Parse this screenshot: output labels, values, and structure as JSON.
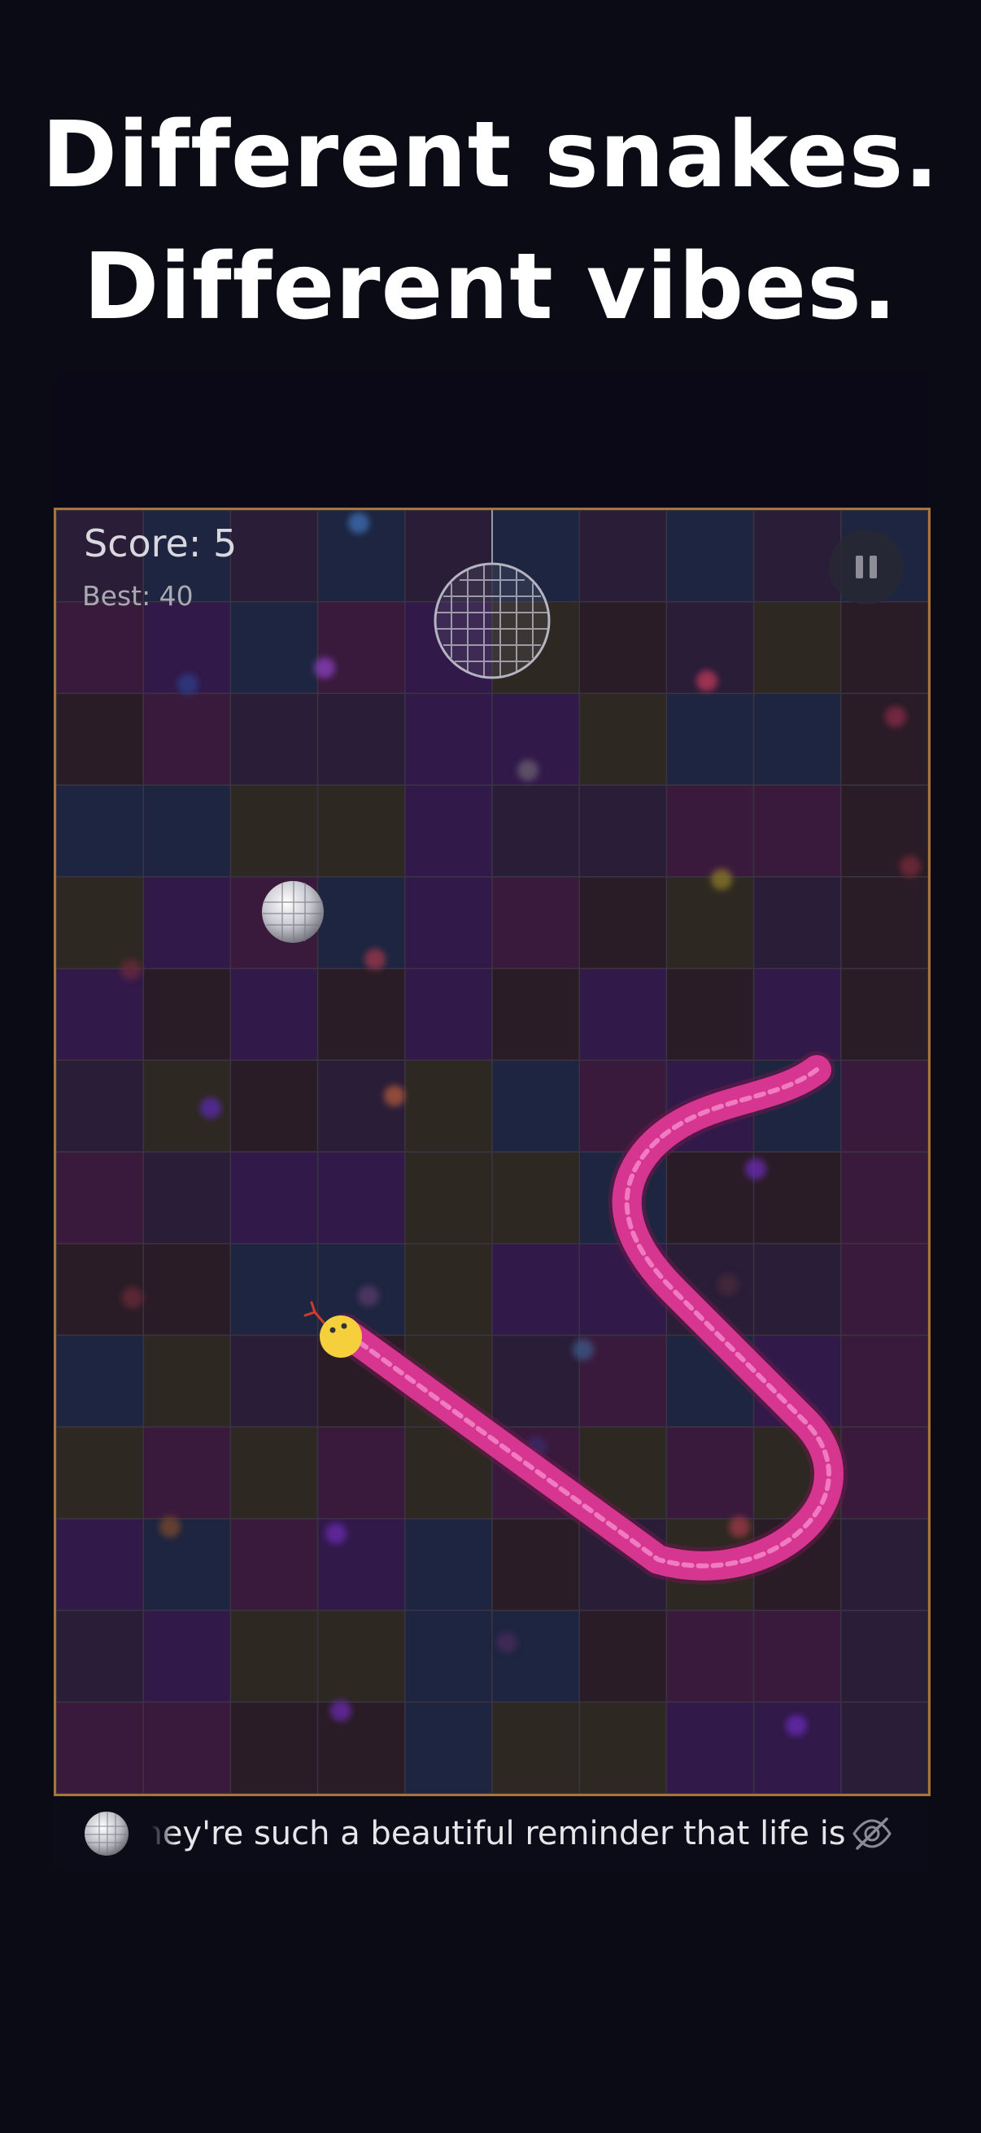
{
  "headline": {
    "line1": "Different snakes.",
    "line2": "Different vibes."
  },
  "hud": {
    "score_text": "Score: 5",
    "best_text": "Best: 40",
    "pause_icon": "pause-icon"
  },
  "board": {
    "columns": 10,
    "rows": 14,
    "border_color": "#a8743a",
    "tile_colors": [
      "#2a1d38",
      "#3a1a3c",
      "#2a1c26",
      "#1d2540",
      "#2e2822",
      "#31194a"
    ],
    "snake_color": "#e0409a",
    "snake_head_color": "#f5cf3c",
    "food": "disco-ball",
    "decoration": "hanging-disco-ball"
  },
  "ticker": {
    "text": "They're such a beautiful reminder that life is",
    "ball_icon": "disco-ball-icon",
    "hide_icon": "eye-slash-icon"
  }
}
